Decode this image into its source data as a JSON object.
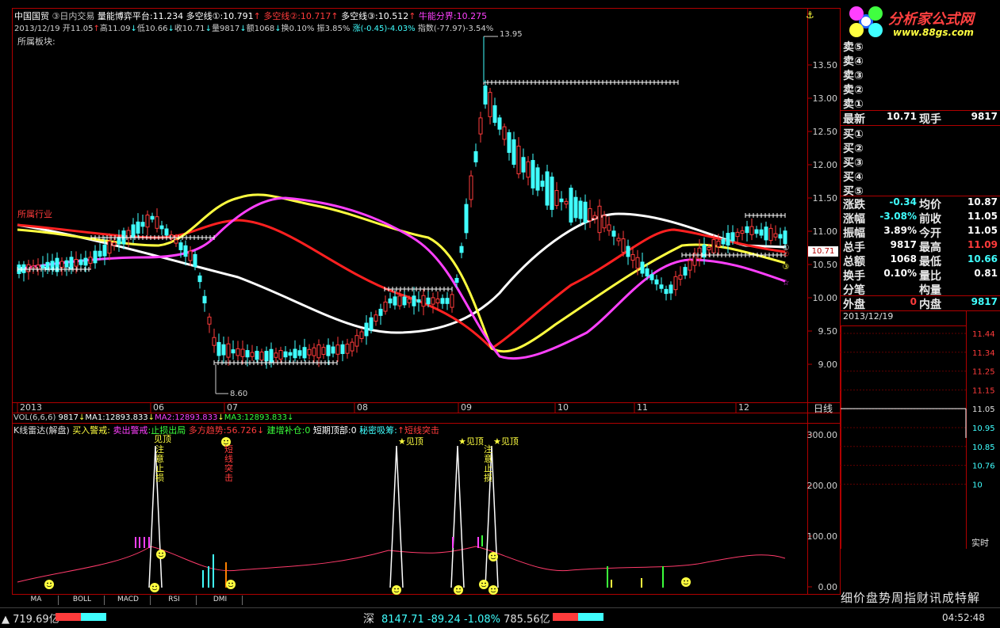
{
  "header": {
    "stock_name": "中国国贸",
    "mode": "③日内交易",
    "indicator_label": "量能博弈平台",
    "indicator_value": ":11.234",
    "duokong1": "多空线①:10.791",
    "duokong2": "多空线②:10.717",
    "duokong3": "多空线③:10.512",
    "niuneng": "牛能分界:10.275"
  },
  "ohlc": {
    "date": "2013/12/19",
    "open": "开11.05",
    "high": "高11.09",
    "low": "低10.66",
    "close": "收10.71",
    "volume": "量9817",
    "amount": "额1068",
    "turnover": "换0.10%",
    "amplitude": "振3.85%",
    "change": "涨(-0.45)-4.03%",
    "index": "指数(-77.97)-3.54%"
  },
  "sector_label": "所属板块:",
  "sector_tag": "所属行业",
  "price_axis": [
    "13.50",
    "13.00",
    "12.50",
    "12.00",
    "11.50",
    "11.00",
    "10.50",
    "10.00",
    "9.50",
    "9.00"
  ],
  "price_labels": {
    "max_marker": "13.95",
    "min_marker": "8.60",
    "current_tag": "10.71"
  },
  "time_axis": [
    "2013",
    "06",
    "07",
    "08",
    "09",
    "10",
    "11",
    "12"
  ],
  "period_label": "日线",
  "vol_line": {
    "label": "VOL(6,6,6)",
    "v": "9817",
    "ma1": "MA1:12893.833",
    "ma2": "MA2:12893.833",
    "ma3": "MA3:12893.833"
  },
  "radar_line": {
    "title": "K线雷达(解盘)",
    "buy_alert": "买入警戒",
    "sell_alert": "卖出警戒",
    "stop_loss": ":止损出局",
    "trend": "多方趋势:56.726",
    "add_pos": "建增补仓:0",
    "short_top": "短期顶部:0",
    "secret": "秘密吸筹",
    "short_break": "短线突击"
  },
  "sub_axis": [
    "300.00",
    "200.00",
    "100.00",
    "0.00"
  ],
  "annotations": [
    "见顶",
    "注意止损",
    "短线突击",
    "见顶",
    "见顶",
    "注意止损",
    "见顶"
  ],
  "tabs": [
    "MA",
    "BOLL",
    "MACD",
    "RSI",
    "DMI"
  ],
  "logo": {
    "title": "分析家公式网",
    "url": "www.88gs.com"
  },
  "orderbook": {
    "sells": [
      "卖⑤",
      "卖④",
      "卖③",
      "卖②",
      "卖①"
    ],
    "buys": [
      "买①",
      "买②",
      "买③",
      "买④",
      "买⑤"
    ],
    "latest_label": "最新",
    "latest": "10.71",
    "hand_label": "现手",
    "hand": "9817",
    "rows": [
      {
        "l": "涨跌",
        "v": "-0.34",
        "v_color": "#40ffff",
        "l2": "均价",
        "v2": "10.87",
        "v2_color": "#ffffff"
      },
      {
        "l": "涨幅",
        "v": "-3.08%",
        "v_color": "#40ffff",
        "l2": "前收",
        "v2": "11.05",
        "v2_color": "#ffffff"
      },
      {
        "l": "振幅",
        "v": "3.89%",
        "v_color": "#ffffff",
        "l2": "今开",
        "v2": "11.05",
        "v2_color": "#ffffff"
      },
      {
        "l": "总手",
        "v": "9817",
        "v_color": "#ffffff",
        "l2": "最高",
        "v2": "11.09",
        "v2_color": "#ff3b3b"
      },
      {
        "l": "总额",
        "v": "1068",
        "v_color": "#ffffff",
        "l2": "最低",
        "v2": "10.66",
        "v2_color": "#40ffff"
      },
      {
        "l": "换手",
        "v": "0.10%",
        "v_color": "#ffffff",
        "l2": "量比",
        "v2": "0.81",
        "v2_color": "#ffffff"
      },
      {
        "l": "分笔",
        "v": "",
        "v_color": "#ffffff",
        "l2": "构量",
        "v2": "",
        "v2_color": "#ffffff"
      }
    ],
    "outer_label": "外盘",
    "outer": "0",
    "inner_label": "内盘",
    "inner": "9817"
  },
  "minichart": {
    "date": "2013/12/19",
    "axis": [
      "11.44",
      "11.34",
      "11.25",
      "11.15",
      "11.05",
      "10.95",
      "10.85",
      "10.76",
      "10"
    ],
    "label": "实时"
  },
  "footer_tabs": "细价盘势周指财讯成特解",
  "status": {
    "left": "719.69亿",
    "market": "深",
    "index": "8147.71",
    "change": "-89.24",
    "pct": "-1.08%",
    "amount": "785.56亿",
    "time": "04:52:48"
  },
  "colors": {
    "up": "#ff3b3b",
    "down": "#40ffff",
    "ma_white": "#ffffff",
    "ma_yellow": "#ffff40",
    "ma_red": "#ff2020",
    "ma_magenta": "#ff40ff"
  }
}
